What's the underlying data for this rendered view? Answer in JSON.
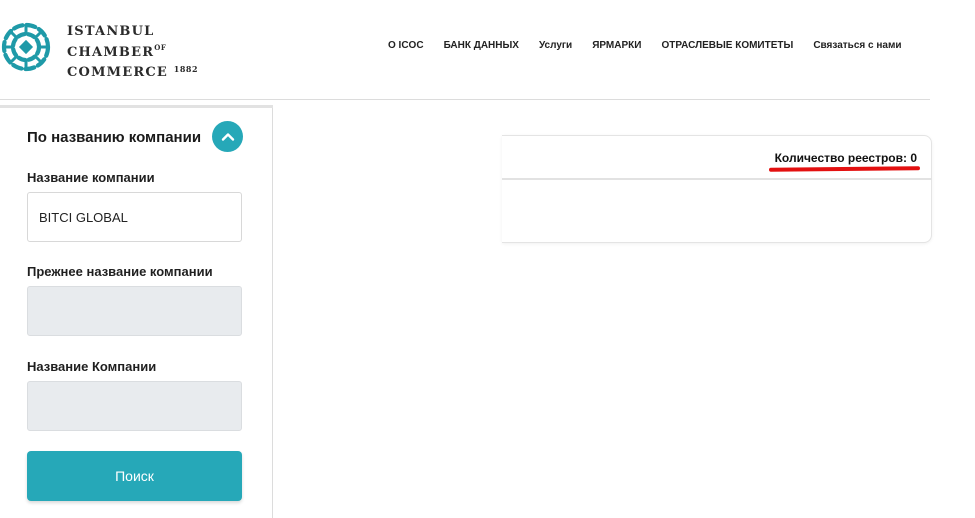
{
  "brand": {
    "line1": "ISTANBUL",
    "line2": "CHAMBER",
    "line2_sup": "OF",
    "line3": "COMMERCE",
    "year": "1882",
    "accent_color": "#1f9aa8"
  },
  "nav": {
    "items": [
      {
        "label": "О ICOC"
      },
      {
        "label": "БАНК ДАННЫХ"
      },
      {
        "label": "Услуги"
      },
      {
        "label": "ЯРМАРКИ"
      },
      {
        "label": "ОТРАСЛЕВЫЕ КОМИТЕТЫ"
      },
      {
        "label": "Связаться с нами"
      }
    ]
  },
  "sidebar": {
    "section_title": "По названию компании",
    "toggle_icon": "chevron-up-icon",
    "fields": [
      {
        "label": "Название компании",
        "value": "BITCI GLOBAL",
        "placeholder": ""
      },
      {
        "label": "Прежнее название компании",
        "value": "",
        "placeholder": ""
      },
      {
        "label": "Название Компании",
        "value": "",
        "placeholder": ""
      }
    ],
    "search_button": "Поиск"
  },
  "results": {
    "count_text": "Количество реестров: 0"
  },
  "colors": {
    "accent": "#26a8b8",
    "annotation_red": "#e31010",
    "disabled_field": "#e8ebee"
  }
}
